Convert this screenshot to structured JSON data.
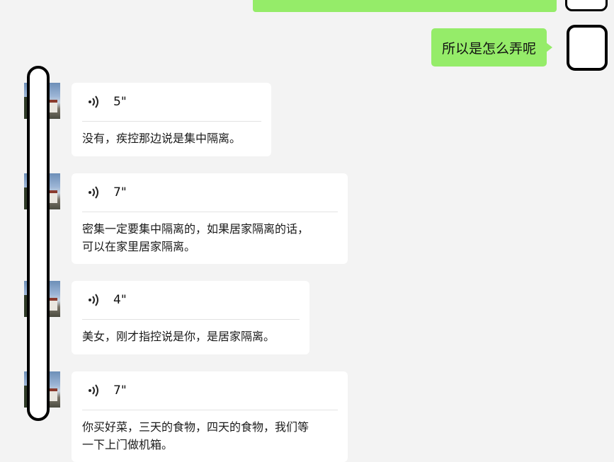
{
  "outgoing": {
    "message": "所以是怎么弄呢"
  },
  "incoming": [
    {
      "duration": "5\"",
      "transcript": "没有，疾控那边说是集中隔离。"
    },
    {
      "duration": "7\"",
      "transcript": "密集一定要集中隔离的，如果居家隔离的话，\n可以在家里居家隔离。"
    },
    {
      "duration": "4\"",
      "transcript": "美女，刚才指控说是你，是居家隔离。"
    },
    {
      "duration": "7\"",
      "transcript": "你买好菜，三天的食物，四天的食物，我们等\n一下上门做机箱。"
    }
  ],
  "icons": {
    "voice": "voice-wave-icon"
  },
  "colors": {
    "background": "#f3f3f3",
    "outgoing_bubble": "#95ec69",
    "incoming_card": "#ffffff"
  }
}
